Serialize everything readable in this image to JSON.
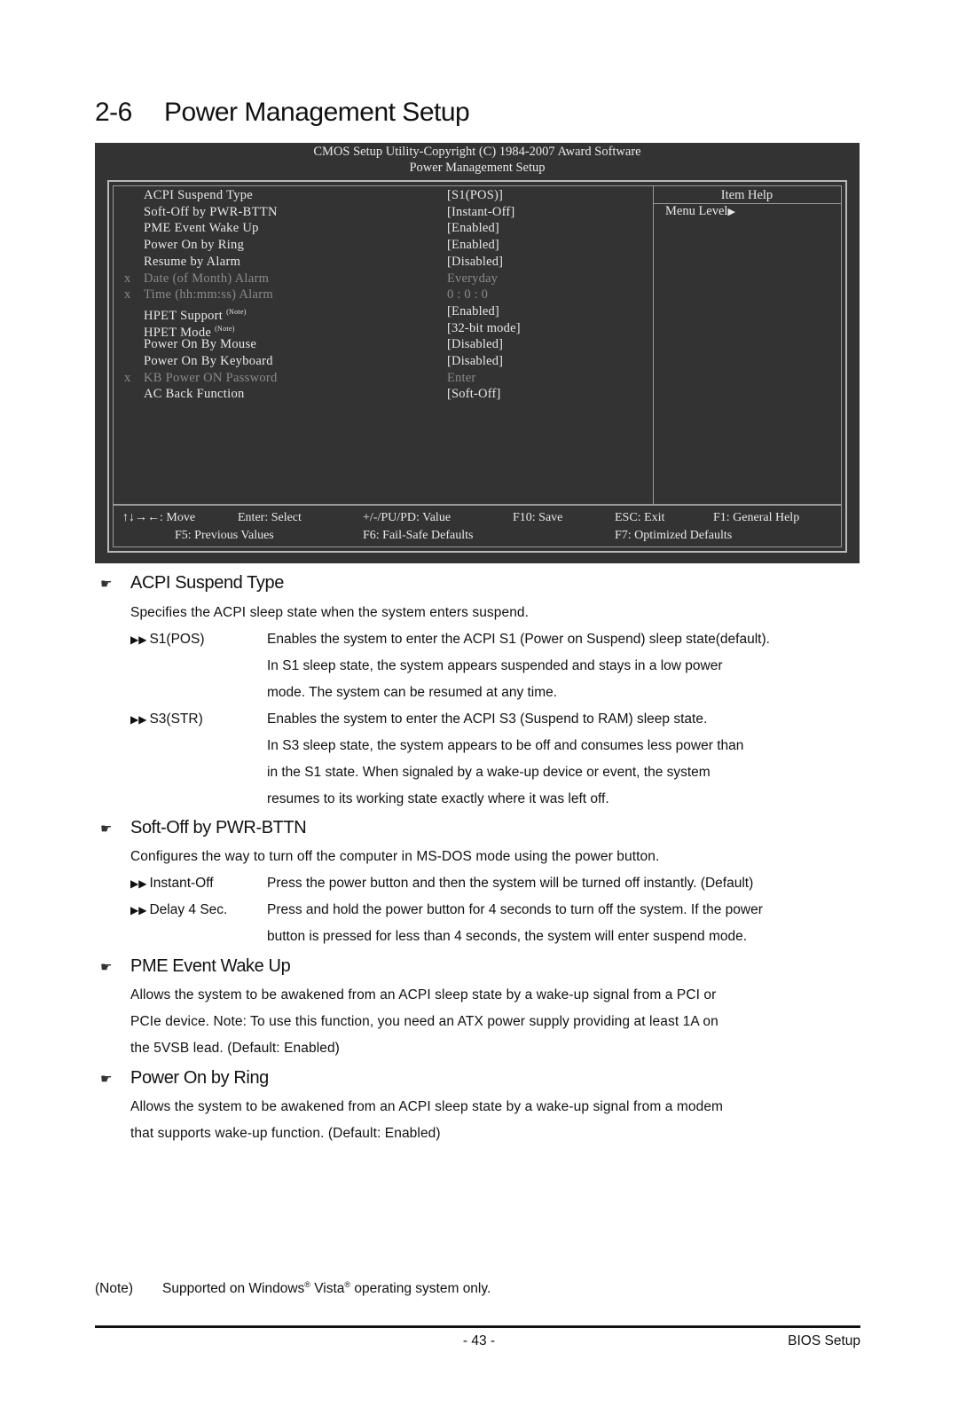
{
  "page": {
    "section_number": "2-6",
    "title": "Power Management Setup"
  },
  "bios": {
    "header_line1": "CMOS Setup Utility-Copyright (C) 1984-2007 Award Software",
    "header_line2": "Power Management Setup",
    "item_help_title": "Item Help",
    "menu_level": "Menu Level",
    "menu_level_icon": "triangle-right-icon",
    "items": [
      {
        "mark": "",
        "label": "ACPI Suspend Type",
        "note": "",
        "value": "[S1(POS)]",
        "disabled": false
      },
      {
        "mark": "",
        "label": "Soft-Off by PWR-BTTN",
        "note": "",
        "value": "[Instant-Off]",
        "disabled": false
      },
      {
        "mark": "",
        "label": "PME Event Wake Up",
        "note": "",
        "value": "[Enabled]",
        "disabled": false
      },
      {
        "mark": "",
        "label": "Power On by Ring",
        "note": "",
        "value": "[Enabled]",
        "disabled": false
      },
      {
        "mark": "",
        "label": "Resume by Alarm",
        "note": "",
        "value": "[Disabled]",
        "disabled": false
      },
      {
        "mark": "x",
        "label": "Date (of Month) Alarm",
        "note": "",
        "value": "Everyday",
        "disabled": true
      },
      {
        "mark": "x",
        "label": "Time (hh:mm:ss) Alarm",
        "note": "",
        "value": "0 : 0 : 0",
        "disabled": true
      },
      {
        "mark": "",
        "label": "HPET Support",
        "note": "(Note)",
        "value": "[Enabled]",
        "disabled": false
      },
      {
        "mark": "",
        "label": "HPET Mode",
        "note": "(Note)",
        "value": "[32-bit mode]",
        "disabled": false
      },
      {
        "mark": "",
        "label": "Power On By Mouse",
        "note": "",
        "value": "[Disabled]",
        "disabled": false
      },
      {
        "mark": "",
        "label": "Power On By Keyboard",
        "note": "",
        "value": "[Disabled]",
        "disabled": false
      },
      {
        "mark": "x",
        "label": "KB Power ON Password",
        "note": "",
        "value": "Enter",
        "disabled": true
      },
      {
        "mark": "",
        "label": "AC Back Function",
        "note": "",
        "value": "[Soft-Off]",
        "disabled": false
      }
    ],
    "keys": {
      "move": "↑↓→←: Move",
      "enter": "Enter: Select",
      "value": "+/-/PU/PD: Value",
      "f10": "F10: Save",
      "esc": "ESC: Exit",
      "f1": "F1: General Help",
      "f5": "F5: Previous Values",
      "f6": "F6: Fail-Safe Defaults",
      "f7": "F7: Optimized Defaults"
    }
  },
  "sections": {
    "acpi": {
      "icon": "pointing-hand-icon",
      "heading": "ACPI Suspend Type",
      "intro": "Specifies the ACPI sleep state when the system enters suspend.",
      "options": [
        {
          "name": "S1(POS)",
          "lines": [
            "Enables the system to enter the ACPI S1 (Power on Suspend) sleep state(default).",
            "In S1 sleep state, the system appears suspended and stays in a low power",
            "mode. The system can be resumed at any time."
          ]
        },
        {
          "name": "S3(STR)",
          "lines": [
            "Enables the system to enter the ACPI S3 (Suspend to RAM) sleep state.",
            "In S3 sleep state, the system appears to be off and consumes less power than",
            "in the S1 state. When signaled by a wake-up device or event, the system",
            "resumes to its working state exactly where it was left off."
          ]
        }
      ]
    },
    "softoff": {
      "icon": "pointing-hand-icon",
      "heading": "Soft-Off by PWR-BTTN",
      "intro": "Configures the way to turn off the computer in MS-DOS mode using the power button.",
      "options": [
        {
          "name": "Instant-Off",
          "lines": [
            "Press the power button and then the system will be turned off instantly. (Default)"
          ]
        },
        {
          "name": "Delay 4 Sec.",
          "lines": [
            "Press and hold the power button for 4 seconds to turn off the system. If the power",
            "button is pressed for less than 4 seconds, the system will enter suspend mode."
          ]
        }
      ]
    },
    "pme": {
      "icon": "pointing-hand-icon",
      "heading": "PME Event Wake Up",
      "lines": [
        "Allows the system to be awakened from an ACPI sleep state by a wake-up signal from a PCI or",
        "PCIe device. Note: To use this function, you need an ATX power supply providing at least 1A on",
        "the 5VSB lead. (Default: Enabled)"
      ]
    },
    "ring": {
      "icon": "pointing-hand-icon",
      "heading": "Power On by Ring",
      "lines": [
        "Allows the system to be awakened from an ACPI sleep state by a wake-up signal from a modem",
        "that supports wake-up function. (Default: Enabled)"
      ]
    }
  },
  "note": {
    "tag": "(Note)",
    "text_before": "Supported on Windows",
    "reg": "®",
    "text_middle": " Vista",
    "text_after": " operating system only."
  },
  "footer": {
    "page_number": "- 43 -",
    "section_name": "BIOS Setup"
  }
}
